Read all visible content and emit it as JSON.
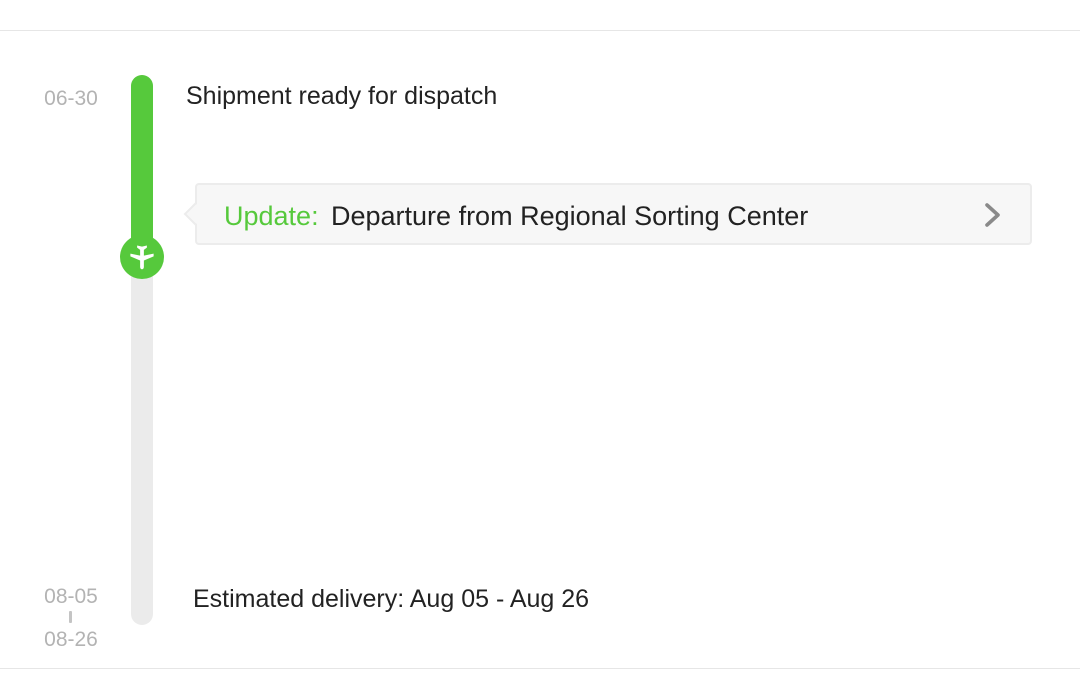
{
  "timeline": {
    "start_date": "06-30",
    "end_date_from": "08-05",
    "end_date_to": "08-26",
    "progress_fraction": 0.33,
    "accent_color": "#56c93c",
    "track_color": "#ebebeb",
    "marker_icon": "airplane-icon"
  },
  "event": {
    "title": "Shipment ready for dispatch"
  },
  "update": {
    "label": "Update:",
    "text": "Departure from Regional Sorting Center",
    "action_icon": "chevron-right-icon"
  },
  "delivery": {
    "text": "Estimated delivery: Aug 05 - Aug 26"
  }
}
